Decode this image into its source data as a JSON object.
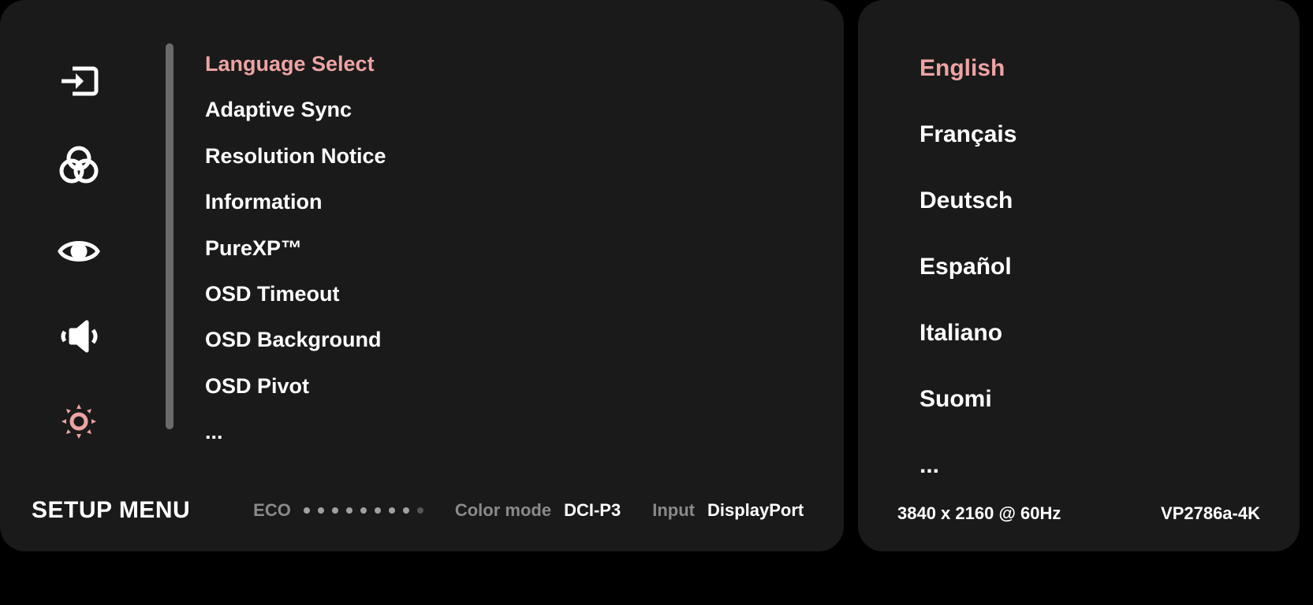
{
  "colors": {
    "accent": "#eea3a3"
  },
  "main": {
    "title": "SETUP MENU",
    "menu": [
      {
        "label": "Language Select",
        "active": true
      },
      {
        "label": "Adaptive Sync",
        "active": false
      },
      {
        "label": "Resolution Notice",
        "active": false
      },
      {
        "label": "Information",
        "active": false
      },
      {
        "label": "PureXP™",
        "active": false
      },
      {
        "label": "OSD Timeout",
        "active": false
      },
      {
        "label": "OSD Background",
        "active": false
      },
      {
        "label": "OSD Pivot",
        "active": false
      },
      {
        "label": "...",
        "active": false
      }
    ],
    "nav_icons": [
      {
        "name": "input-icon",
        "active": false
      },
      {
        "name": "color-adjust-icon",
        "active": false
      },
      {
        "name": "view-mode-icon",
        "active": false
      },
      {
        "name": "audio-icon",
        "active": false
      },
      {
        "name": "settings-icon",
        "active": true
      }
    ],
    "footer": {
      "eco_label": "ECO",
      "eco_level": 8,
      "eco_max": 9,
      "color_mode_label": "Color mode",
      "color_mode_value": "DCI-P3",
      "input_label": "Input",
      "input_value": "DisplayPort"
    }
  },
  "side": {
    "languages": [
      {
        "label": "English",
        "active": true
      },
      {
        "label": "Français",
        "active": false
      },
      {
        "label": "Deutsch",
        "active": false
      },
      {
        "label": "Español",
        "active": false
      },
      {
        "label": "Italiano",
        "active": false
      },
      {
        "label": "Suomi",
        "active": false
      },
      {
        "label": "...",
        "active": false
      }
    ],
    "footer": {
      "resolution": "3840 x 2160 @ 60Hz",
      "model": "VP2786a-4K"
    }
  }
}
